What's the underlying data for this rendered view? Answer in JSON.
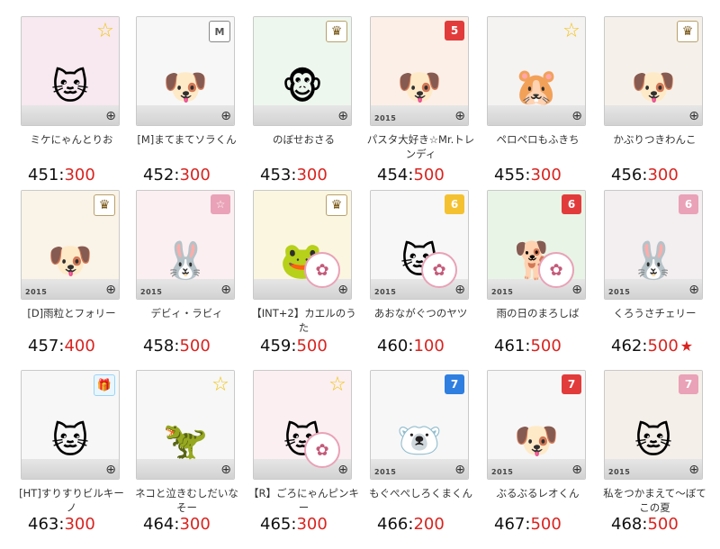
{
  "items": [
    {
      "name": "ミケにゃんとりお",
      "id": "451",
      "sep": ":",
      "price": "300",
      "mark": "",
      "subject": "🐱",
      "badge": "☆",
      "badgeType": "star",
      "zoom": "⊕",
      "year": "",
      "bg": "#f7e9ef"
    },
    {
      "name": "[M]まてまてソラくん",
      "id": "452",
      "sep": ":",
      "price": "300",
      "mark": "",
      "subject": "🐶",
      "badge": "M",
      "badgeType": "logo",
      "zoom": "⊕",
      "year": "",
      "bg": "#f7f7f7"
    },
    {
      "name": "のぼせおさる",
      "id": "453",
      "sep": ":",
      "price": "300",
      "mark": "",
      "subject": "🐵",
      "badge": "♛",
      "badgeType": "crown",
      "zoom": "⊕",
      "year": "",
      "bg": "#eef7ee"
    },
    {
      "name": "パスタ大好き☆Mr.トレンディ",
      "id": "454",
      "sep": ":",
      "price": "500",
      "mark": "",
      "subject": "🐶",
      "badge": "5",
      "badgeType": "num-red",
      "zoom": "⊕",
      "year": "2015",
      "bg": "#fbefe7"
    },
    {
      "name": "ペロペロもふきち",
      "id": "455",
      "sep": ":",
      "price": "300",
      "mark": "",
      "subject": "🐹",
      "badge": "☆",
      "badgeType": "star",
      "zoom": "⊕",
      "year": "",
      "bg": "#f5f2f2"
    },
    {
      "name": "かぶりつきわんこ",
      "id": "456",
      "sep": ":",
      "price": "300",
      "mark": "",
      "subject": "🐶",
      "badge": "♛",
      "badgeType": "crown",
      "zoom": "⊕",
      "year": "",
      "bg": "#f5f1ea"
    },
    {
      "name": "[D]雨粒とフォリー",
      "id": "457",
      "sep": ":",
      "price": "400",
      "mark": "",
      "subject": "🐶",
      "badge": "♛",
      "badgeType": "crown",
      "zoom": "⊕",
      "year": "2015",
      "bg": "#faf3e8"
    },
    {
      "name": "デビィ・ラビィ",
      "id": "458",
      "sep": ":",
      "price": "500",
      "mark": "",
      "subject": "🐰",
      "badge": "☆",
      "badgeType": "num-pink",
      "zoom": "⊕",
      "year": "2015",
      "bg": "#fbeff1"
    },
    {
      "name": "【INT+2】カエルのうた",
      "id": "459",
      "sep": ":",
      "price": "500",
      "mark": "",
      "subject": "🐸",
      "badge": "♛",
      "badgeType": "crown",
      "zoom": "⊕",
      "year": "",
      "bg": "#fbf6e0"
    },
    {
      "name": "あおながぐつのヤツ",
      "id": "460",
      "sep": ":",
      "price": "100",
      "mark": "",
      "subject": "🐱",
      "badge": "6",
      "badgeType": "num-yellow",
      "zoom": "⊕",
      "year": "2015",
      "bg": "#f7f7f7"
    },
    {
      "name": "雨の日のまろしば",
      "id": "461",
      "sep": ":",
      "price": "500",
      "mark": "",
      "subject": "🐕",
      "badge": "6",
      "badgeType": "num-red",
      "zoom": "⊕",
      "year": "2015",
      "bg": "#e8f4e6"
    },
    {
      "name": "くろうさチェリー",
      "id": "462",
      "sep": ":",
      "price": "500",
      "mark": "★",
      "subject": "🐰",
      "badge": "6",
      "badgeType": "num-pink",
      "zoom": "⊕",
      "year": "2015",
      "bg": "#f3eef0"
    },
    {
      "name": "[HT]すりすりビルキーノ",
      "id": "463",
      "sep": ":",
      "price": "300",
      "mark": "",
      "subject": "🐱",
      "badge": "🎁",
      "badgeType": "gift",
      "zoom": "⊕",
      "year": "",
      "bg": "#f7f7f7"
    },
    {
      "name": "ネコと泣きむしだいなそー",
      "id": "464",
      "sep": ":",
      "price": "300",
      "mark": "",
      "subject": "🦖",
      "badge": "☆",
      "badgeType": "star",
      "zoom": "⊕",
      "year": "",
      "bg": "#f7f7f7"
    },
    {
      "name": "【R】ごろにゃんピンキー",
      "id": "465",
      "sep": ":",
      "price": "300",
      "mark": "",
      "subject": "🐱",
      "badge": "☆",
      "badgeType": "star",
      "zoom": "⊕",
      "year": "",
      "bg": "#fbeff2"
    },
    {
      "name": "もぐぺぺしろくまくん",
      "id": "466",
      "sep": ":",
      "price": "200",
      "mark": "",
      "subject": "🐻‍❄️",
      "badge": "7",
      "badgeType": "num-blue",
      "zoom": "⊕",
      "year": "2015",
      "bg": "#f7f7f7"
    },
    {
      "name": "ぶるぶるレオくん",
      "id": "467",
      "sep": ":",
      "price": "500",
      "mark": "",
      "subject": "🐶",
      "badge": "7",
      "badgeType": "num-red",
      "zoom": "⊕",
      "year": "2015",
      "bg": "#f7f7f7"
    },
    {
      "name": "私をつかまえて〜ぼてこの夏",
      "id": "468",
      "sep": ":",
      "price": "500",
      "mark": "",
      "subject": "🐱",
      "badge": "7",
      "badgeType": "num-pink",
      "zoom": "⊕",
      "year": "2015",
      "bg": "#f4efe8"
    }
  ]
}
